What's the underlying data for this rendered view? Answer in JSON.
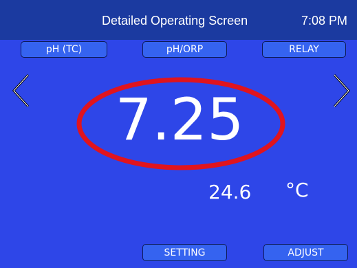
{
  "header": {
    "title": "Detailed Operating Screen",
    "time": "7:08 PM"
  },
  "tabs": [
    {
      "label": "pH (TC)"
    },
    {
      "label": "pH/ORP"
    },
    {
      "label": "RELAY"
    }
  ],
  "reading": {
    "value": "7.25",
    "temperature": "24.6",
    "temperature_unit": "°C"
  },
  "footer": {
    "setting_label": "SETTING",
    "adjust_label": "ADJUST"
  },
  "icons": {
    "prev": "chevron-left-icon",
    "next": "chevron-right-icon"
  },
  "colors": {
    "header_bg": "#1b3aa0",
    "body_bg": "#2e46e8",
    "button_bg": "#3563f0",
    "highlight": "#e0141e"
  }
}
